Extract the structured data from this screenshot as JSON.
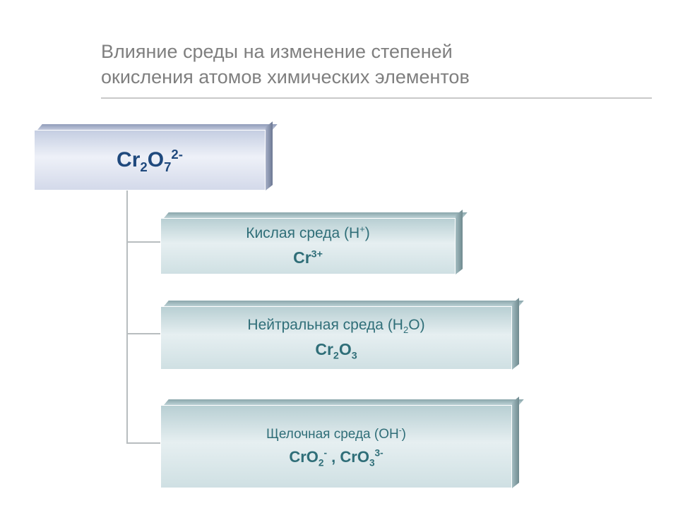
{
  "title_line1": "Влияние среды на изменение степеней",
  "title_line2": "окисления атомов химических элементов",
  "root": {
    "formula_html": "Cr<sub>2</sub>O<sub>7</sub><sup>2-</sup>"
  },
  "children": [
    {
      "env_html": "Кислая среда (H<sup>+</sup>)",
      "formula_html": "Cr<sup>3+</sup>"
    },
    {
      "env_html": "Нейтральная среда (H<sub>2</sub>O)",
      "formula_html": "Cr<sub>2</sub>O<sub>3</sub>"
    },
    {
      "env_html": "Щелочная среда (OH<sup>-</sup>)",
      "formula_html": "CrO<sub>2</sub><sup>-</sup> , CrO<sub>3</sub><sup>3-</sup>"
    }
  ],
  "chart_data": {
    "type": "table",
    "title": "Влияние среды на изменение степеней окисления атомов химических элементов",
    "root_species": "Cr2O7^2-",
    "branches": [
      {
        "environment": "Кислая среда (H+)",
        "product": "Cr^3+"
      },
      {
        "environment": "Нейтральная среда (H2O)",
        "product": "Cr2O3"
      },
      {
        "environment": "Щелочная среда (OH-)",
        "product": "CrO2^- , CrO3^3-"
      }
    ]
  }
}
